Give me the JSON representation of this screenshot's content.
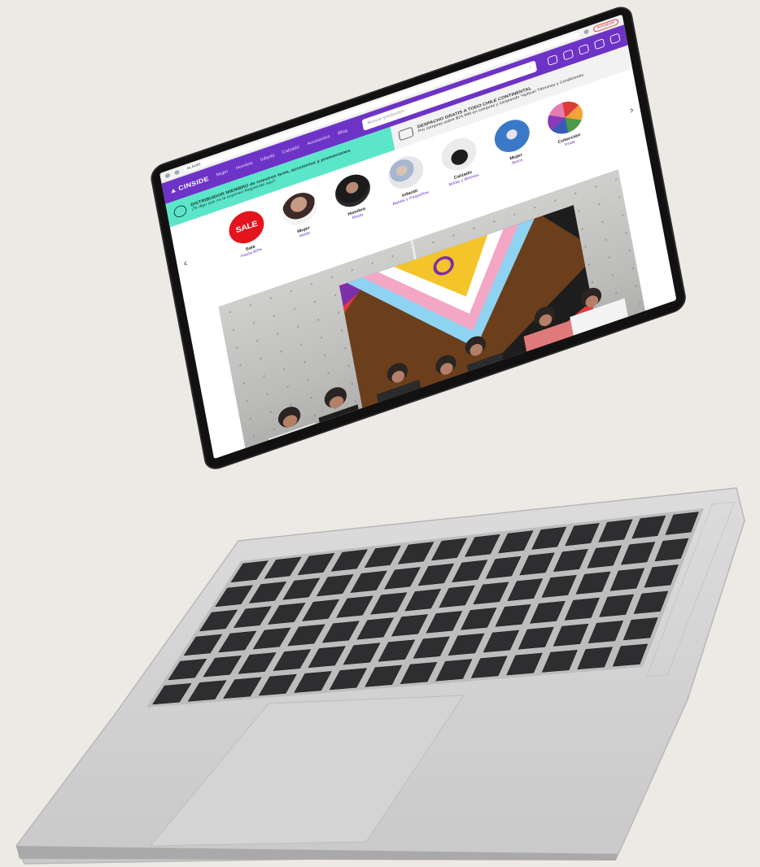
{
  "browser": {
    "url": "la.kobi",
    "update_label": "Actualizar"
  },
  "site": {
    "logo": "CINSIDE",
    "nav_links": [
      "Mujer",
      "Hombre",
      "Infantil",
      "Calzado",
      "Accesorios",
      "Blog"
    ],
    "search_placeholder": "Buscar productos",
    "icons": [
      "user-icon",
      "mail-icon",
      "store-icon",
      "heart-icon",
      "cart-icon"
    ]
  },
  "promos": {
    "left": {
      "title": "DISTRIBUIDOR MIEMBRO de nuestros tenis, accesorios y promociones",
      "subtitle": "¡Te digo que no te esperas! Regístrate aquí!"
    },
    "right": {
      "title": "DESPACHO GRATIS A TODO CHILE CONTINENTAL",
      "subtitle": "Por compras sobre $24.990 en compras y canjeando *Aplican Términos y Condiciones"
    }
  },
  "categories": [
    {
      "title": "Sale",
      "subtitle": "Hasta 60%",
      "circle_text": "SALE"
    },
    {
      "title": "Mujer",
      "subtitle": "Moda"
    },
    {
      "title": "Hombre",
      "subtitle": "Moda"
    },
    {
      "title": "Infantil",
      "subtitle": "Bebés y Pequeños"
    },
    {
      "title": "Calzado",
      "subtitle": "Botas y Botines"
    },
    {
      "title": "Mujer",
      "subtitle": "Jeans"
    },
    {
      "title": "Colección",
      "subtitle": "Pride"
    }
  ],
  "colors": {
    "brand_purple": "#6d33c7",
    "promo_green": "#5ce6c9",
    "sale_red": "#e3141e",
    "background": "#ede9e4"
  }
}
